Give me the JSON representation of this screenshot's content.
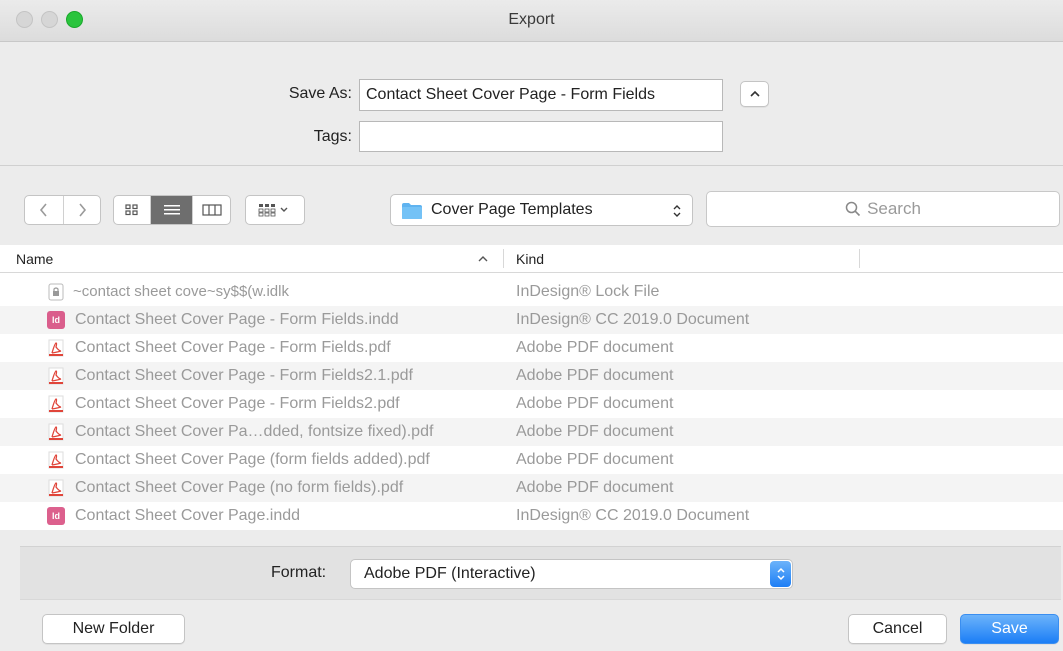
{
  "window": {
    "title": "Export"
  },
  "save": {
    "save_as_label": "Save As:",
    "filename": "Contact Sheet Cover Page - Form Fields",
    "tags_label": "Tags:",
    "tags_value": ""
  },
  "toolbar": {
    "location": "Cover Page Templates",
    "search_placeholder": "Search"
  },
  "table": {
    "columns": {
      "name": "Name",
      "kind": "Kind"
    },
    "rows": [
      {
        "name": "~contact sheet cove~sy$$(w.idlk",
        "kind": "InDesign® Lock File",
        "icon": "lock-file-icon"
      },
      {
        "name": "Contact Sheet Cover Page - Form Fields.indd",
        "kind": "InDesign® CC 2019.0 Document",
        "icon": "indesign-file-icon"
      },
      {
        "name": "Contact Sheet Cover Page - Form Fields.pdf",
        "kind": "Adobe PDF document",
        "icon": "pdf-file-icon"
      },
      {
        "name": "Contact Sheet Cover Page - Form Fields2.1.pdf",
        "kind": "Adobe PDF document",
        "icon": "pdf-file-icon"
      },
      {
        "name": "Contact Sheet Cover Page - Form Fields2.pdf",
        "kind": "Adobe PDF document",
        "icon": "pdf-file-icon"
      },
      {
        "name": "Contact Sheet Cover Pa…dded, fontsize fixed).pdf",
        "kind": "Adobe PDF document",
        "icon": "pdf-file-icon"
      },
      {
        "name": "Contact Sheet Cover Page (form fields added).pdf",
        "kind": "Adobe PDF document",
        "icon": "pdf-file-icon"
      },
      {
        "name": "Contact Sheet Cover Page (no form fields).pdf",
        "kind": "Adobe PDF document",
        "icon": "pdf-file-icon"
      },
      {
        "name": "Contact Sheet Cover Page.indd",
        "kind": "InDesign® CC 2019.0 Document",
        "icon": "indesign-file-icon"
      }
    ]
  },
  "format": {
    "label": "Format:",
    "value": "Adobe PDF (Interactive)"
  },
  "buttons": {
    "new_folder": "New Folder",
    "cancel": "Cancel",
    "save": "Save"
  },
  "colors": {
    "accent": "#1b7ef6",
    "indesign": "#d6457a",
    "pdf": "#e0453a",
    "folder": "#5fb3f0"
  }
}
